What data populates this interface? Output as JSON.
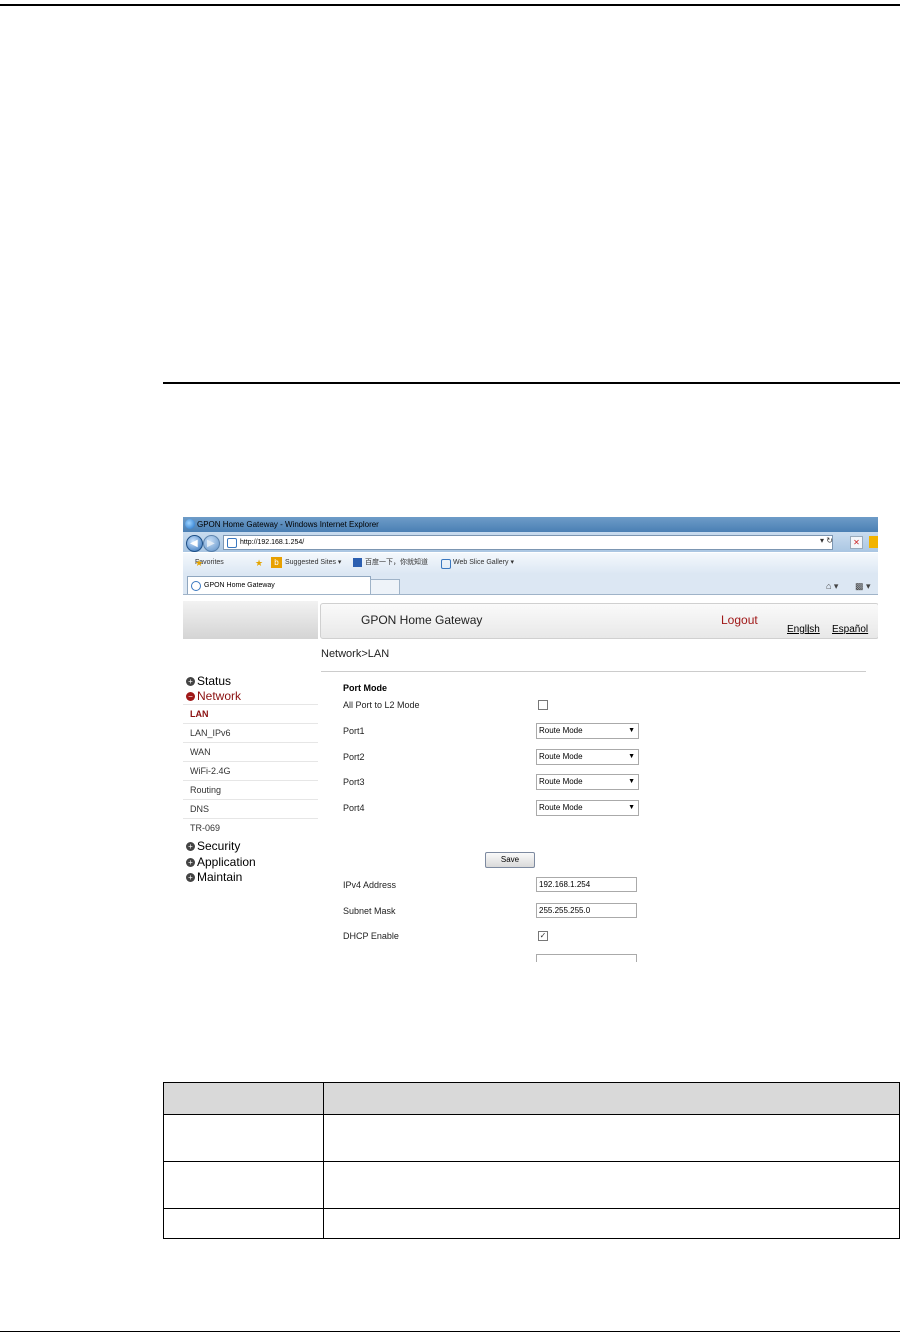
{
  "browser": {
    "title": "GPON Home Gateway - Windows Internet Explorer",
    "url": "http://192.168.1.254/",
    "favorites_label": "Favorites",
    "suggested_sites": "Suggested Sites ▾",
    "baidu": "百度一下，你就知道",
    "web_slice": "Web Slice Gallery ▾",
    "tab_title": "GPON Home Gateway"
  },
  "app": {
    "title": "GPON Home Gateway",
    "logout": "Logout",
    "lang_english": "English",
    "lang_sep": "|",
    "lang_espanol": "Español",
    "breadcrumb": "Network>LAN"
  },
  "menu": {
    "status": "Status",
    "network": "Network",
    "sub": [
      "LAN",
      "LAN_IPv6",
      "WAN",
      "WiFi-2.4G",
      "Routing",
      "DNS",
      "TR-069"
    ],
    "security": "Security",
    "application": "Application",
    "maintain": "Maintain"
  },
  "form": {
    "section": "Port Mode",
    "all_port_label": "All Port to L2 Mode",
    "ports": [
      {
        "label": "Port1",
        "value": "Route Mode"
      },
      {
        "label": "Port2",
        "value": "Route Mode"
      },
      {
        "label": "Port3",
        "value": "Route Mode"
      },
      {
        "label": "Port4",
        "value": "Route Mode"
      }
    ],
    "save": "Save",
    "ipv4_label": "IPv4 Address",
    "ipv4_value": "192.168.1.254",
    "mask_label": "Subnet Mask",
    "mask_value": "255.255.255.0",
    "dhcp_label": "DHCP Enable",
    "dhcp_checked": "✓"
  }
}
